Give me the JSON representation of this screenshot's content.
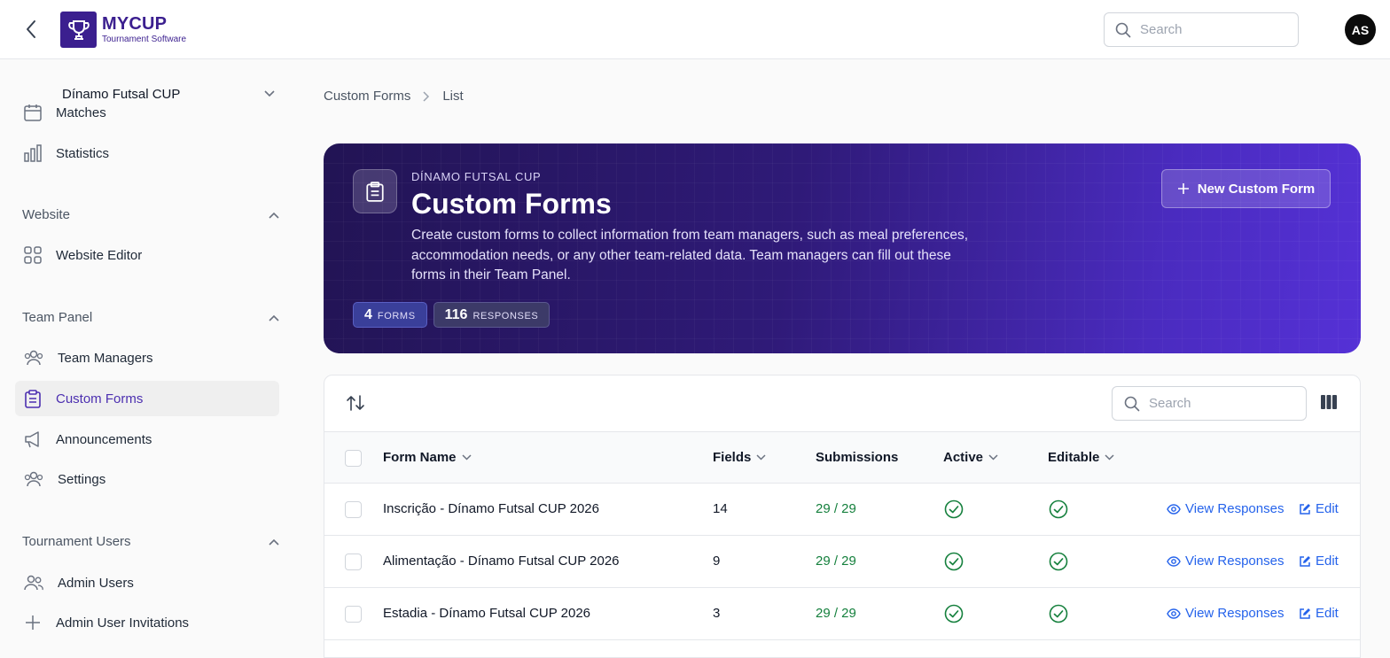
{
  "app": {
    "logo_title": "MYCUP",
    "logo_subtitle": "Tournament Software",
    "search_placeholder": "Search",
    "avatar_initials": "AS"
  },
  "sidebar": {
    "tournament": "Dínamo Futsal CUP",
    "items_top": [
      {
        "label": "Matches",
        "icon": "calendar-icon"
      },
      {
        "label": "Statistics",
        "icon": "bar-chart-icon"
      }
    ],
    "sections": [
      {
        "label": "Website",
        "items": [
          {
            "label": "Website Editor",
            "icon": "grid-icon"
          }
        ]
      },
      {
        "label": "Team Panel",
        "items": [
          {
            "label": "Team Managers",
            "icon": "users-icon"
          },
          {
            "label": "Custom Forms",
            "icon": "clipboard-icon",
            "active": true
          },
          {
            "label": "Announcements",
            "icon": "megaphone-icon"
          },
          {
            "label": "Settings",
            "icon": "users-icon"
          }
        ]
      },
      {
        "label": "Tournament Users",
        "items": [
          {
            "label": "Admin Users",
            "icon": "users-icon"
          },
          {
            "label": "Admin User Invitations",
            "icon": "plus-icon"
          }
        ]
      }
    ]
  },
  "breadcrumb": [
    "Custom Forms",
    "List"
  ],
  "hero": {
    "eyebrow": "DÍNAMO FUTSAL CUP",
    "title": "Custom Forms",
    "description": "Create custom forms to collect information from team managers, such as meal preferences, accommodation needs, or any other team-related data. Team managers can fill out these forms in their Team Panel.",
    "forms_count": "4",
    "forms_unit": "FORMS",
    "responses_count": "116",
    "responses_unit": "RESPONSES",
    "new_button": "New Custom Form"
  },
  "table": {
    "search_placeholder": "Search",
    "columns": [
      "Form Name",
      "Fields",
      "Submissions",
      "Active",
      "Editable"
    ],
    "rows": [
      {
        "name": "Inscrição - Dínamo Futsal CUP 2026",
        "fields": "14",
        "submissions": "29 / 29",
        "active": true,
        "editable": true
      },
      {
        "name": "Alimentação - Dínamo Futsal CUP 2026",
        "fields": "9",
        "submissions": "29 / 29",
        "active": true,
        "editable": true
      },
      {
        "name": "Estadia - Dínamo Futsal CUP 2026",
        "fields": "3",
        "submissions": "29 / 29",
        "active": true,
        "editable": true
      }
    ],
    "view_label": "View Responses",
    "edit_label": "Edit"
  },
  "colors": {
    "brand": "#3b1f8f",
    "active_nav": "#4c2fb0",
    "link": "#2563eb",
    "success": "#15803d"
  }
}
